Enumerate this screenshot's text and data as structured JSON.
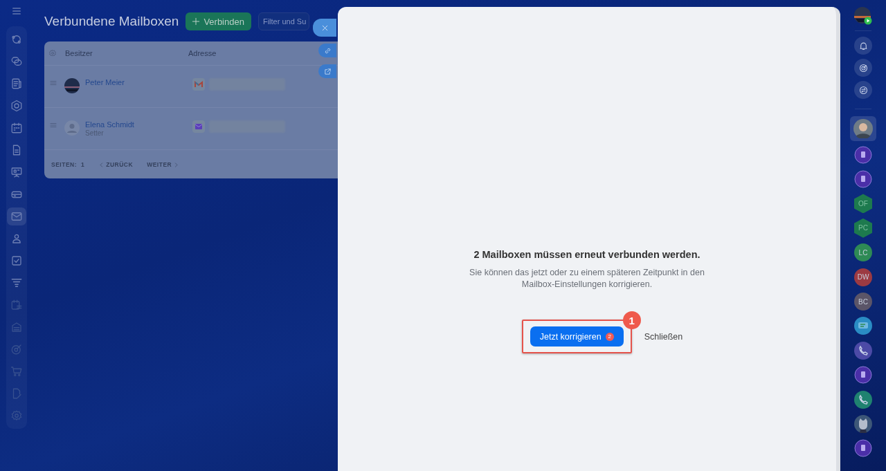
{
  "sidebar": {
    "items": [
      {
        "kind": "feed",
        "selected": false
      },
      {
        "kind": "chat",
        "selected": false
      },
      {
        "kind": "news",
        "selected": false
      },
      {
        "kind": "hexagon",
        "selected": false
      },
      {
        "kind": "calendar",
        "selected": false
      },
      {
        "kind": "document",
        "selected": false
      },
      {
        "kind": "presentation",
        "selected": false
      },
      {
        "kind": "drive",
        "selected": false
      },
      {
        "kind": "mail",
        "selected": true
      },
      {
        "kind": "contacts",
        "selected": false
      },
      {
        "kind": "tasks",
        "selected": false
      },
      {
        "kind": "funnel",
        "selected": false
      },
      {
        "kind": "planner",
        "selected": false
      },
      {
        "kind": "warehouse",
        "selected": false
      },
      {
        "kind": "target",
        "selected": false
      },
      {
        "kind": "cart",
        "selected": false
      },
      {
        "kind": "sign",
        "selected": false
      },
      {
        "kind": "settings",
        "selected": false
      }
    ]
  },
  "page": {
    "title": "Verbundene Mailboxen",
    "connect_button": "Verbinden",
    "filter": {
      "placeholder": "Filter und Su"
    }
  },
  "table": {
    "columns": [
      "Besitzer",
      "Adresse"
    ],
    "rows": [
      {
        "owner": "Peter Meier",
        "avatar": {
          "kind": "photo"
        },
        "provider": {
          "kind": "gmail"
        }
      },
      {
        "owner": "Elena Schmidt",
        "role": "Setter",
        "avatar": {
          "kind": "default"
        },
        "provider": {
          "kind": "mail"
        }
      }
    ]
  },
  "pagination": {
    "label": "SEITEN:",
    "page": "1",
    "prev": "ZURÜCK",
    "next": "WEITER"
  },
  "dialog": {
    "title": "2 Mailboxen müssen erneut verbunden werden.",
    "text": "Sie können das jetzt oder zu einem späteren Zeitpunkt in den Mailbox-Einstellungen korrigieren.",
    "primary_button": {
      "label": "Jetzt korrigieren",
      "badge": "2"
    },
    "secondary_button": "Schließen",
    "annotation": {
      "number": "1"
    }
  },
  "right_bar": {
    "contacts": [
      {
        "kind": "photo",
        "selected": true
      },
      {
        "kind": "channel",
        "selected": false
      },
      {
        "kind": "channel",
        "selected": false
      },
      {
        "kind": "hexagon",
        "initials": "OF",
        "color": "#1d7a4e",
        "selected": false
      },
      {
        "kind": "hexagon",
        "initials": "PC",
        "color": "#1d7a4e",
        "selected": false
      },
      {
        "kind": "circle",
        "initials": "LC",
        "color": "#2e8a55",
        "selected": false
      },
      {
        "kind": "circle",
        "initials": "DW",
        "color": "#9c3a42",
        "selected": false
      },
      {
        "kind": "circle",
        "initials": "BC",
        "color": "#5b5568",
        "selected": false
      },
      {
        "kind": "chat",
        "selected": false
      },
      {
        "kind": "phone",
        "color": "#4c4aa6",
        "selected": false
      },
      {
        "kind": "channel",
        "selected": false
      },
      {
        "kind": "phone",
        "color": "#1f8270",
        "selected": false
      },
      {
        "kind": "cat",
        "selected": false
      },
      {
        "kind": "channel",
        "selected": false
      }
    ]
  }
}
